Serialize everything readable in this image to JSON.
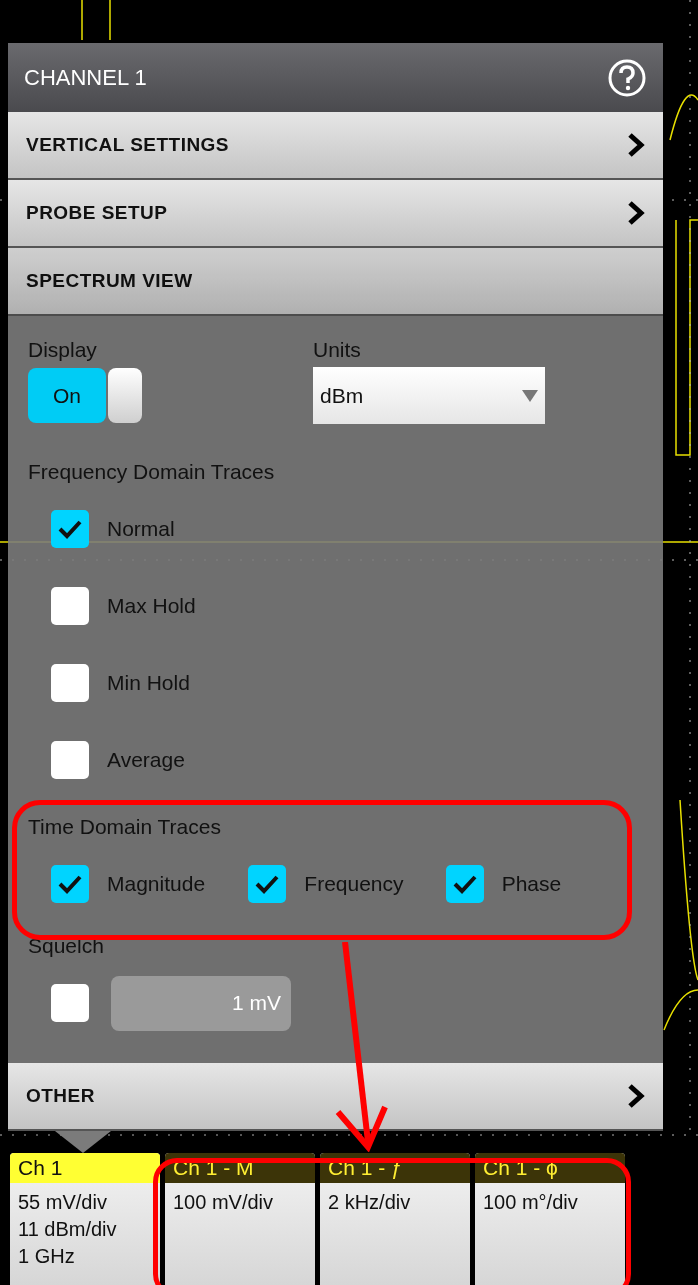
{
  "panel": {
    "title": "CHANNEL 1",
    "sections": [
      {
        "label": "VERTICAL SETTINGS",
        "expanded": false
      },
      {
        "label": "PROBE SETUP",
        "expanded": false
      },
      {
        "label": "SPECTRUM VIEW",
        "expanded": true
      }
    ],
    "display": {
      "label": "Display",
      "toggle": "On",
      "on": true
    },
    "units": {
      "label": "Units",
      "value": "dBm"
    },
    "frequency_traces": {
      "label": "Frequency Domain Traces",
      "items": [
        {
          "label": "Normal",
          "checked": true
        },
        {
          "label": "Max Hold",
          "checked": false
        },
        {
          "label": "Min Hold",
          "checked": false
        },
        {
          "label": "Average",
          "checked": false
        }
      ]
    },
    "time_traces": {
      "label": "Time Domain Traces",
      "items": [
        {
          "label": "Magnitude",
          "checked": true
        },
        {
          "label": "Frequency",
          "checked": true
        },
        {
          "label": "Phase",
          "checked": true
        }
      ]
    },
    "squelch": {
      "label": "Squelch",
      "checked": false,
      "value": "1 mV"
    },
    "other": {
      "label": "OTHER",
      "expanded": false
    }
  },
  "badges": [
    {
      "title": "Ch 1",
      "lines": [
        "55 mV/div",
        "11 dBm/div",
        "1 GHz"
      ],
      "selected": true
    },
    {
      "title": "Ch 1 - M",
      "lines": [
        "100 mV/div"
      ],
      "selected": false
    },
    {
      "title": "Ch 1 - ƒ",
      "lines": [
        "2 kHz/div"
      ],
      "selected": false
    },
    {
      "title": "Ch 1 - ϕ",
      "lines": [
        "100 m°/div"
      ],
      "selected": false
    }
  ]
}
